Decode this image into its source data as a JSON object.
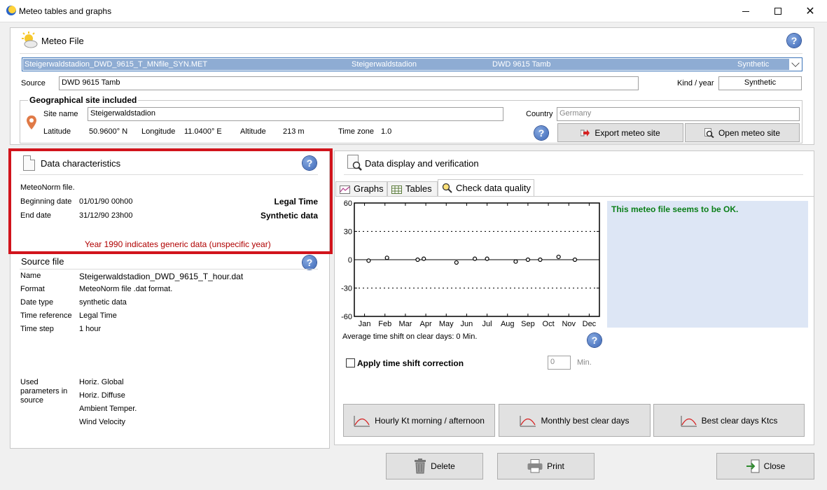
{
  "window": {
    "title": "Meteo tables and graphs"
  },
  "meteo_file": {
    "heading": "Meteo File",
    "selected": {
      "filename": "Steigerwaldstadion_DWD_9615_T_MNfile_SYN.MET",
      "site": "Steigerwaldstadion",
      "source": "DWD 9615 Tamb",
      "kind": "Synthetic"
    },
    "source_label": "Source",
    "source_value": "DWD 9615 Tamb",
    "kind_label": "Kind / year",
    "kind_value": "Synthetic"
  },
  "geo": {
    "legend": "Geographical site included",
    "site_name_label": "Site name",
    "site_name_value": "Steigerwaldstadion",
    "country_label": "Country",
    "country_value": "Germany",
    "latitude_label": "Latitude",
    "latitude_value": "50.9600° N",
    "longitude_label": "Longitude",
    "longitude_value": "11.0400° E",
    "altitude_label": "Altitude",
    "altitude_value": "213 m",
    "timezone_label": "Time zone",
    "timezone_value": "1.0",
    "export_button": "Export meteo site",
    "open_button": "Open meteo site"
  },
  "data_characteristics": {
    "heading": "Data characteristics",
    "file_type": "MeteoNorm file.",
    "begin_label": "Beginning date",
    "begin_value": "01/01/90 00h00",
    "begin_note": "Legal Time",
    "end_label": "End date",
    "end_value": "31/12/90 23h00",
    "end_note": "Synthetic data",
    "warning": "Year 1990 indicates generic data (unspecific year)",
    "warning_color": "#b00000"
  },
  "source_file": {
    "heading": "Source file",
    "rows": [
      {
        "label": "Name",
        "value": "Steigerwaldstadion_DWD_9615_T_hour.dat"
      },
      {
        "label": "Format",
        "value": "MeteoNorm file .dat format."
      },
      {
        "label": "Date type",
        "value": "synthetic data"
      },
      {
        "label": "Time reference",
        "value": "Legal Time"
      },
      {
        "label": "Time step",
        "value": "1 hour"
      }
    ],
    "used_label_1": "Used",
    "used_label_2": "parameters in",
    "used_label_3": "source",
    "parameters": [
      "Horiz. Global",
      "Horiz. Diffuse",
      "Ambient Temper.",
      "Wind Velocity"
    ]
  },
  "display": {
    "heading": "Data display and verification",
    "tabs": [
      "Graphs",
      "Tables",
      "Check data quality"
    ],
    "ok_message": "This meteo file seems to be OK.",
    "ok_color": "#0b7f19",
    "avg_shift": "Average time shift on clear days: 0 Min.",
    "apply_label": "Apply time shift correction",
    "shift_value": "0",
    "shift_unit": "Min.",
    "buttons": [
      "Hourly Kt morning / afternoon",
      "Monthly best clear days",
      "Best clear days Ktcs"
    ]
  },
  "chart_data": {
    "type": "scatter",
    "categories": [
      "Jan",
      "Feb",
      "Mar",
      "Apr",
      "May",
      "Jun",
      "Jul",
      "Aug",
      "Sep",
      "Oct",
      "Nov",
      "Dec"
    ],
    "ylim": [
      -60,
      60
    ],
    "yticks": [
      "60",
      "30",
      "0",
      "-30",
      "-60"
    ],
    "points": [
      {
        "x": 1.2,
        "y": -1
      },
      {
        "x": 2.1,
        "y": 2
      },
      {
        "x": 3.6,
        "y": 0
      },
      {
        "x": 3.9,
        "y": 1
      },
      {
        "x": 5.5,
        "y": -3
      },
      {
        "x": 6.4,
        "y": 1
      },
      {
        "x": 7.0,
        "y": 1
      },
      {
        "x": 8.4,
        "y": -2
      },
      {
        "x": 9.0,
        "y": 0
      },
      {
        "x": 9.6,
        "y": 0
      },
      {
        "x": 10.5,
        "y": 3
      },
      {
        "x": 11.3,
        "y": 0
      }
    ],
    "grid": "dotted lines at ±30"
  },
  "footer": {
    "delete": "Delete",
    "print": "Print",
    "close": "Close"
  }
}
